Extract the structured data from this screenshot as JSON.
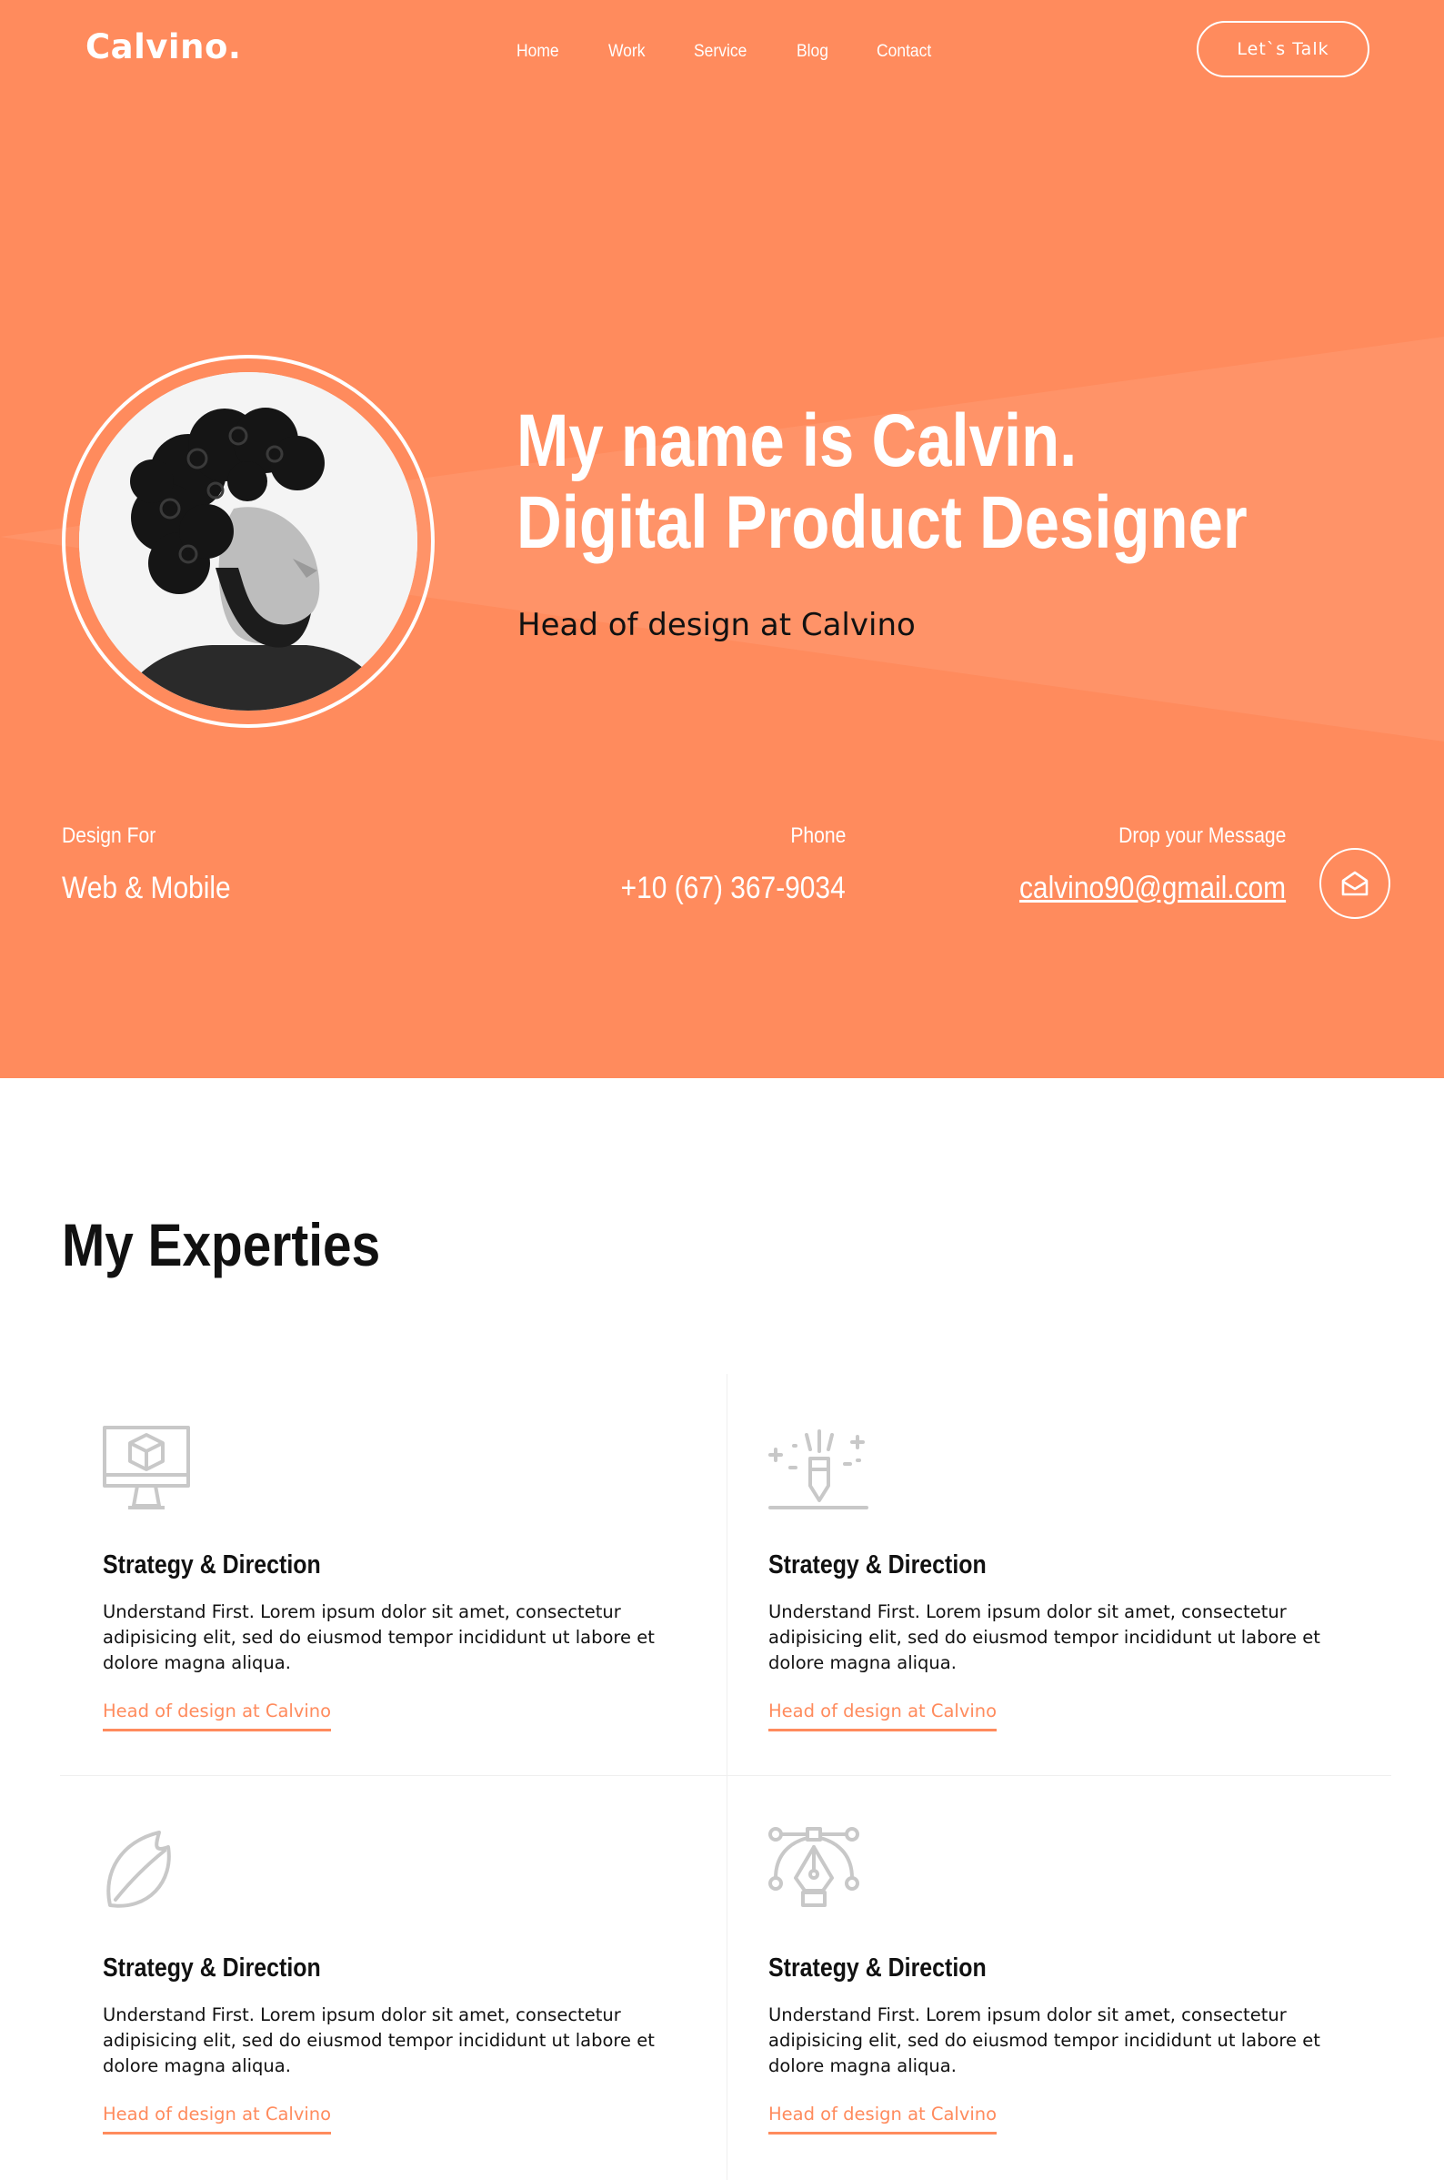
{
  "nav": {
    "logo": "Calvino.",
    "items": [
      {
        "label": "Home"
      },
      {
        "label": "Work"
      },
      {
        "label": "Service"
      },
      {
        "label": "Blog"
      },
      {
        "label": "Contact"
      }
    ],
    "cta_label": "Let`s Talk"
  },
  "hero": {
    "title_line1": "My name is Calvin.",
    "title_line2": "Digital Product Designer",
    "subtitle": "Head of design at Calvino",
    "design_for_label": "Design For",
    "design_for_value": "Web & Mobile",
    "phone_label": "Phone",
    "phone_value": "+10 (67) 367-9034",
    "message_label": "Drop your Message",
    "message_value": "calvino90@gmail.com",
    "mail_icon": "envelope-open-icon"
  },
  "experties": {
    "title": "My Experties",
    "cards": [
      {
        "icon": "monitor-cube-icon",
        "title": "Strategy & Direction",
        "text": "Understand First. Lorem ipsum dolor sit amet, consectetur adipisicing elit, sed do eiusmod tempor incididunt ut labore et dolore magna aliqua.",
        "link": "Head of design at Calvino"
      },
      {
        "icon": "pen-sparkle-icon",
        "title": "Strategy & Direction",
        "text": "Understand First. Lorem ipsum dolor sit amet, consectetur adipisicing elit, sed do eiusmod tempor incididunt ut labore et dolore magna aliqua.",
        "link": "Head of design at Calvino"
      },
      {
        "icon": "leaf-icon",
        "title": "Strategy & Direction",
        "text": "Understand First. Lorem ipsum dolor sit amet, consectetur adipisicing elit, sed do eiusmod tempor incididunt ut labore et dolore magna aliqua.",
        "link": "Head of design at Calvino"
      },
      {
        "icon": "vector-pen-tool-icon",
        "title": "Strategy & Direction",
        "text": "Understand First. Lorem ipsum dolor sit amet, consectetur adipisicing elit, sed do eiusmod tempor incididunt ut labore et dolore magna aliqua.",
        "link": "Head of design at Calvino"
      }
    ]
  },
  "colors": {
    "accent": "#ff8b5d",
    "text": "#111111",
    "icon_gray": "#c8c8c8"
  }
}
